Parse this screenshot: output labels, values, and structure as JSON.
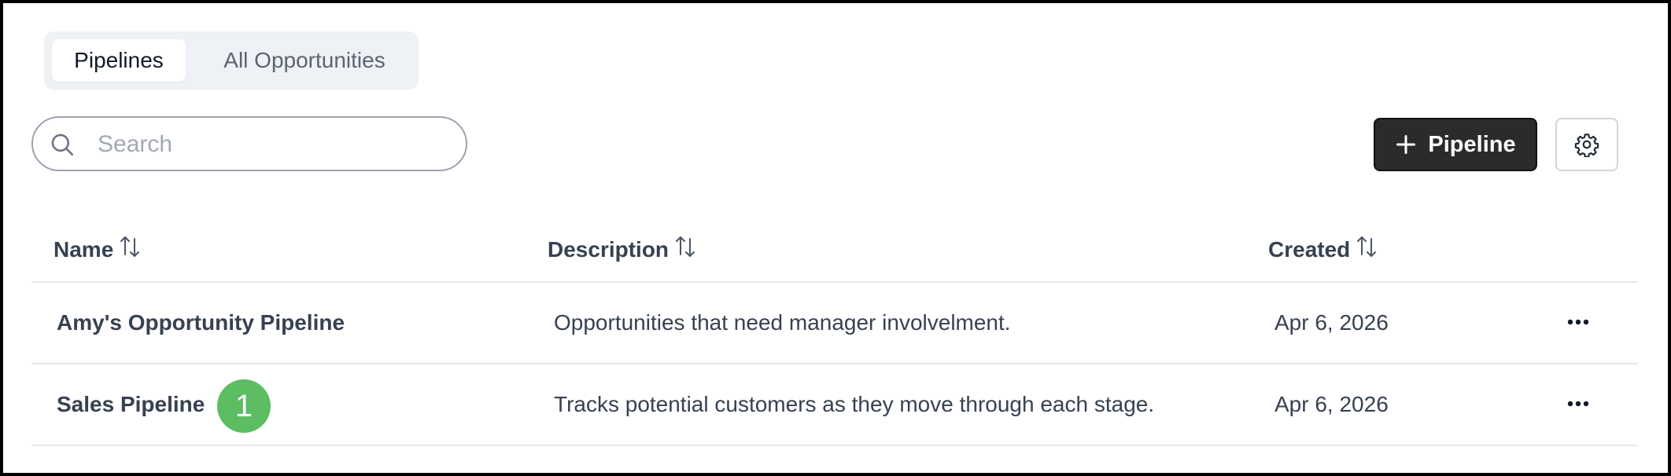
{
  "tabs": [
    {
      "label": "Pipelines",
      "active": true
    },
    {
      "label": "All Opportunities",
      "active": false
    }
  ],
  "search": {
    "placeholder": "Search",
    "value": ""
  },
  "toolbar": {
    "add_label": "Pipeline",
    "settings_icon": "gear-icon"
  },
  "table": {
    "columns": [
      "Name",
      "Description",
      "Created"
    ],
    "rows": [
      {
        "name": "Amy's Opportunity Pipeline",
        "description": "Opportunities that need manager involvelment.",
        "created": "Apr 6, 2026"
      },
      {
        "name": "Sales Pipeline",
        "description": "Tracks potential customers as they move through each stage.",
        "created": "Apr 6, 2026"
      }
    ]
  },
  "annotation_badge": {
    "label": "1",
    "color": "#5cbd62"
  },
  "colors": {
    "primary_button": "#2b2b2b",
    "tab_bar_bg": "#eef1f5"
  }
}
